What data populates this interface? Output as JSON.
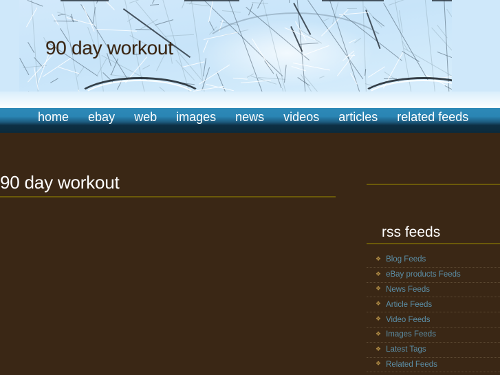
{
  "site": {
    "logo_text": "90 day workout",
    "background_color": "#3a2715",
    "header_color": "#cfe8fa",
    "accent_rule_color": "#6b5a09",
    "link_color": "#5b8ea6",
    "nav_top_color": "#2d89b8",
    "nav_bottom_color": "#0b2a3c"
  },
  "nav": {
    "items": [
      {
        "label": "home"
      },
      {
        "label": "ebay"
      },
      {
        "label": "web"
      },
      {
        "label": "images"
      },
      {
        "label": "news"
      },
      {
        "label": "videos"
      },
      {
        "label": "articles"
      },
      {
        "label": "related feeds"
      }
    ]
  },
  "main": {
    "title": "90 day workout"
  },
  "sidebar": {
    "heading": "rss feeds",
    "bullet_glyph": "❖",
    "items": [
      {
        "label": "Blog Feeds"
      },
      {
        "label": "eBay products Feeds"
      },
      {
        "label": "News Feeds"
      },
      {
        "label": "Article Feeds"
      },
      {
        "label": "Video Feeds"
      },
      {
        "label": "Images Feeds"
      },
      {
        "label": "Latest Tags"
      },
      {
        "label": "Related Feeds"
      }
    ]
  }
}
